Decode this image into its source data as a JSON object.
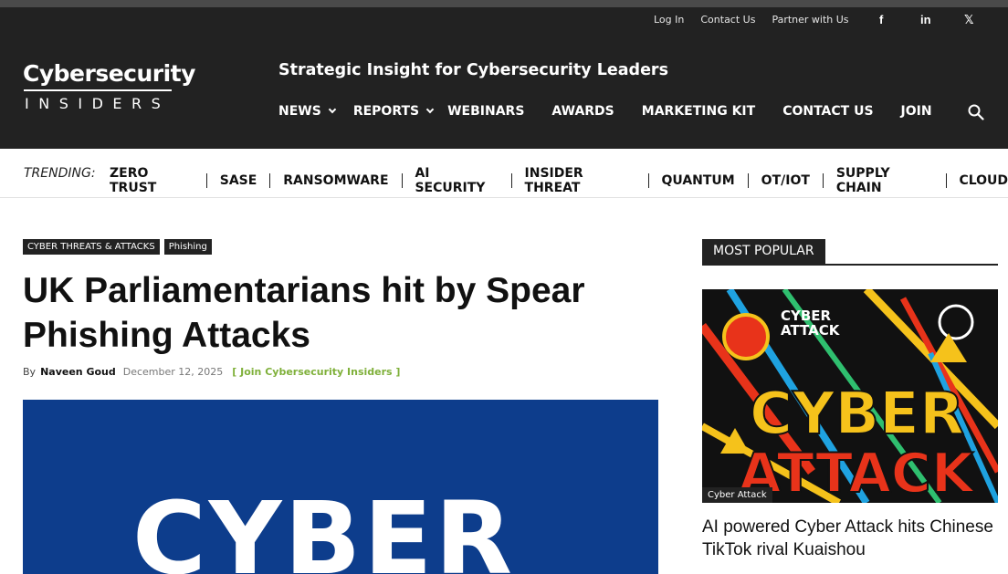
{
  "header": {
    "top_links": [
      "Log In",
      "Contact Us",
      "Partner with Us"
    ],
    "social": [
      {
        "icon": "facebook-icon",
        "glyph": "f"
      },
      {
        "icon": "linkedin-icon",
        "glyph": "in"
      },
      {
        "icon": "x-icon",
        "glyph": "𝕏"
      }
    ],
    "logo_main": "Cybersecurity",
    "logo_sub": "INSIDERS",
    "tagline": "Strategic Insight for Cybersecurity Leaders",
    "nav": [
      {
        "label": "NEWS",
        "dropdown": true
      },
      {
        "label": "REPORTS",
        "dropdown": true
      },
      {
        "label": "WEBINARS",
        "dropdown": false
      },
      {
        "label": "AWARDS",
        "dropdown": false
      },
      {
        "label": "MARKETING KIT",
        "dropdown": false
      },
      {
        "label": "CONTACT US",
        "dropdown": false
      },
      {
        "label": "JOIN",
        "dropdown": false
      }
    ]
  },
  "trending": {
    "label": "TRENDING:",
    "items": [
      "ZERO TRUST",
      "SASE",
      "RANSOMWARE",
      "AI SECURITY",
      "INSIDER THREAT",
      "QUANTUM",
      "OT/IOT",
      "SUPPLY CHAIN",
      "CLOUD"
    ]
  },
  "article": {
    "categories": [
      "CYBER THREATS & ATTACKS",
      "Phishing"
    ],
    "title": "UK Parliamentarians hit by Spear Phishing Attacks",
    "by": "By",
    "author": "Naveen Goud",
    "date": "December 12, 2025",
    "join": "[ Join Cybersecurity Insiders ]",
    "hero_text": "CYBER"
  },
  "sidebar": {
    "heading": "MOST POPULAR",
    "thumb_label": "Cyber Attack",
    "thumb_text_small": "CYBER ATTACK",
    "thumb_text_big_1": "CYBER",
    "thumb_text_big_2": "ATTACK",
    "post_title": "AI powered Cyber Attack hits Chinese TikTok rival Kuaishou"
  },
  "colors": {
    "header_bg": "#222222",
    "hero_bg": "#0d3d8c",
    "join_link": "#7fb03a"
  }
}
